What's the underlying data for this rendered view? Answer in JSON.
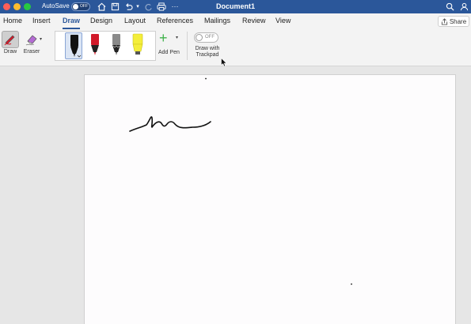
{
  "titlebar": {
    "autosave_label": "AutoSave",
    "autosave_state": "OFF",
    "document_title": "Document1",
    "icons": [
      "home-icon",
      "save-icon",
      "undo-icon",
      "redo-icon",
      "print-icon",
      "more-icon",
      "search-icon",
      "account-icon"
    ]
  },
  "tabs": [
    "Home",
    "Insert",
    "Draw",
    "Design",
    "Layout",
    "References",
    "Mailings",
    "Review",
    "View"
  ],
  "active_tab": "Draw",
  "share_label": "Share",
  "ribbon": {
    "draw_label": "Draw",
    "eraser_label": "Eraser",
    "pens": [
      {
        "name": "black-pen",
        "color": "#000000"
      },
      {
        "name": "red-pen",
        "color": "#d11a2a"
      },
      {
        "name": "gray-pen",
        "color": "#7a7a7a"
      },
      {
        "name": "yellow-highlighter",
        "color": "#f4ee3a"
      }
    ],
    "add_pen_label": "Add Pen",
    "trackpad_toggle": "OFF",
    "trackpad_label_line1": "Draw with",
    "trackpad_label_line2": "Trackpad"
  },
  "colors": {
    "titlebar": "#2b579a",
    "accent": "#2b579a",
    "add_pen": "#3fb24a"
  }
}
